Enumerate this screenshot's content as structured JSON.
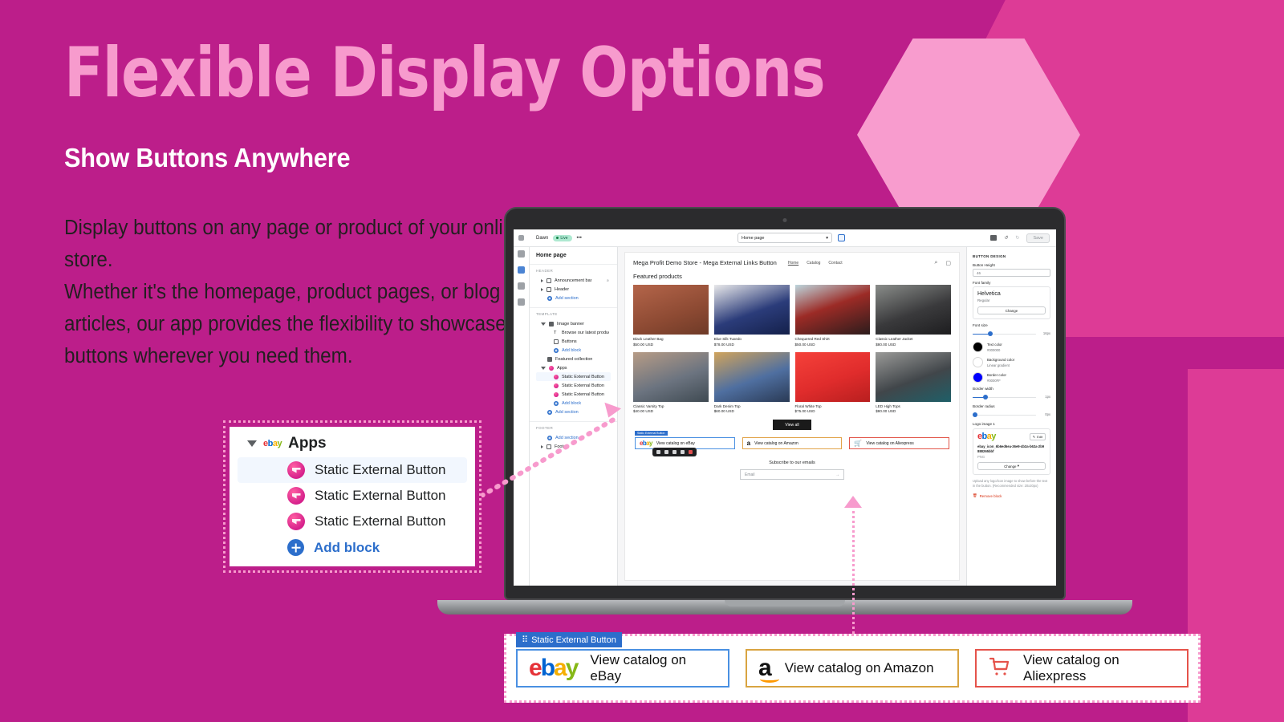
{
  "hero": {
    "title": "Flexible Display Options",
    "subtitle": "Show Buttons Anywhere",
    "body": "Display buttons on any page or product of your online store.\nWhether it's the homepage, product pages, or blog articles, our app provides the flexibility to showcase buttons wherever you need them."
  },
  "colors": {
    "background": "#BC1E8A",
    "background_accent": "#DD3B96",
    "hexagon": "#F89CCE",
    "title": "#F79BCD",
    "callout_border": "#F79BCD",
    "link_blue": "#2C6ECB",
    "ebay_border": "#4A90E2",
    "amazon_border": "#D9A441",
    "aliexpress_border": "#E5534B"
  },
  "apps_callout": {
    "group_label": "Apps",
    "group_icon": "ebay-icon",
    "caret_icon": "caret-down-icon",
    "blocks": [
      {
        "label": "Static External Button",
        "selected": true
      },
      {
        "label": "Static External Button",
        "selected": false
      },
      {
        "label": "Static External Button",
        "selected": false
      }
    ],
    "add_block_label": "Add block",
    "add_block_icon": "plus-circle-icon"
  },
  "editor": {
    "topbar": {
      "theme_name": "Dawn",
      "status_badge": "Live",
      "more_icon": "ellipsis-icon",
      "sidebar_toggle_icon": "panel-toggle-icon",
      "page_selector_value": "Home page",
      "page_selector_caret": "chevron-down-icon",
      "inspector_icon": "inspector-icon",
      "device_icon": "device-preview-icon",
      "undo_icon": "undo-icon",
      "redo_icon": "redo-icon",
      "save_label": "Save"
    },
    "rail_icons": [
      "sections-icon",
      "theme-settings-icon",
      "apps-icon"
    ],
    "sidebar": {
      "page_title": "Home page",
      "groups": [
        {
          "label": "HEADER",
          "items": [
            {
              "label": "Announcement bar",
              "indent": 1,
              "icon": "section-icon",
              "arrow": "collapsed",
              "trailing_icon": "hidden-eye-icon"
            },
            {
              "label": "Header",
              "indent": 1,
              "icon": "section-icon",
              "arrow": "collapsed"
            }
          ],
          "add_label": "Add section"
        },
        {
          "label": "TEMPLATE",
          "items": [
            {
              "label": "Image banner",
              "indent": 1,
              "icon": "image-icon",
              "arrow": "open"
            },
            {
              "label": "Browse our latest products",
              "indent": 3,
              "icon": "text-icon"
            },
            {
              "label": "Buttons",
              "indent": 3,
              "icon": "buttons-icon"
            },
            {
              "label": "Add block",
              "indent": 3,
              "icon": "plus-circle-icon",
              "link": true
            },
            {
              "label": "Featured collection",
              "indent": 1,
              "icon": "collection-icon"
            },
            {
              "label": "Apps",
              "indent": 1,
              "icon": "apps-icon",
              "arrow": "open"
            },
            {
              "label": "Static External Button",
              "indent": 3,
              "icon": "block-icon",
              "selected": true
            },
            {
              "label": "Static External Button",
              "indent": 3,
              "icon": "block-icon"
            },
            {
              "label": "Static External Button",
              "indent": 3,
              "icon": "block-icon"
            },
            {
              "label": "Add block",
              "indent": 3,
              "icon": "plus-circle-icon",
              "link": true
            }
          ],
          "add_label": "Add section"
        },
        {
          "label": "FOOTER",
          "items": [
            {
              "label": "Footer",
              "indent": 1,
              "icon": "section-icon",
              "arrow": "collapsed"
            }
          ],
          "add_label": "Add section"
        }
      ]
    },
    "preview": {
      "store_title": "Mega Profit Demo Store - Mega External Links Button",
      "nav": [
        "Home",
        "Catalog",
        "Contact"
      ],
      "search_icon": "search-icon",
      "cart_icon": "cart-icon",
      "section_title": "Featured products",
      "products": [
        {
          "name": "Black Leather Bag",
          "price": "$50.00 USD"
        },
        {
          "name": "Blue Silk Tuxedo",
          "price": "$78.00 USD"
        },
        {
          "name": "Chequered Red Shirt",
          "price": "$50.00 USD"
        },
        {
          "name": "Classic Leather Jacket",
          "price": "$80.00 USD"
        },
        {
          "name": "Classic Varsity Top",
          "price": "$40.00 USD"
        },
        {
          "name": "Dark Denim Top",
          "price": "$60.00 USD"
        },
        {
          "name": "Floral White Top",
          "price": "$75.00 USD"
        },
        {
          "name": "LED High Tops",
          "price": "$80.00 USD"
        }
      ],
      "view_all_label": "View all",
      "block_tag": "Static External Button",
      "external_buttons": [
        {
          "label": "View catalog on eBay",
          "logo": "ebay-logo"
        },
        {
          "label": "View catalog on Amazon",
          "logo": "amazon-logo"
        },
        {
          "label": "View catalog on Aliexpress",
          "logo": "aliexpress-cart-logo"
        }
      ],
      "float_toolbar_icons": [
        "move-up-icon",
        "move-down-icon",
        "duplicate-icon",
        "hide-icon",
        "delete-icon"
      ],
      "newsletter_title": "Subscribe to our emails",
      "newsletter_placeholder": "Email",
      "newsletter_submit_icon": "arrow-right-icon"
    },
    "panel": {
      "heading": "BUTTON DESIGN",
      "button_height_label": "Button Height",
      "button_height_value": "46",
      "font_family_label": "Font family",
      "font_name": "Helvetica",
      "font_style": "Regular",
      "change_label": "Change",
      "font_size_label": "Font size",
      "font_size_value": "16px",
      "colors": [
        {
          "title": "Text color",
          "value": "#000000",
          "swatch": "#000000"
        },
        {
          "title": "Background color",
          "value": "Linear gradient",
          "swatch": "#ffffff"
        },
        {
          "title": "Border color",
          "value": "#0000FF",
          "swatch": "#0000FF"
        }
      ],
      "border_width_label": "Border width",
      "border_width_value": "1px",
      "border_radius_label": "Border radius",
      "border_radius_value": "0px",
      "logo_label": "Logo image 1",
      "logo_preview": "ebay-logo",
      "edit_label": "Edit",
      "edit_icon": "pencil-icon",
      "file_name": "ebay_icon_6b6ed6ea-36e9-4b3a-b62a-2b9888265bbf",
      "file_type": "PNG",
      "change_logo_label": "Change",
      "help_text": "Upload any logo/icon image to show before the text in the button. (Recommended size: 20x20px)",
      "remove_label": "Remove block",
      "remove_icon": "trash-icon"
    }
  },
  "bottom_callout": {
    "tag": "Static External Button",
    "tag_icon": "block-handle-icon",
    "buttons": [
      {
        "label": "View catalog on eBay",
        "logo": "ebay-logo"
      },
      {
        "label": "View catalog on Amazon",
        "logo": "amazon-logo"
      },
      {
        "label": "View catalog on Aliexpress",
        "logo": "aliexpress-cart-logo"
      }
    ]
  }
}
